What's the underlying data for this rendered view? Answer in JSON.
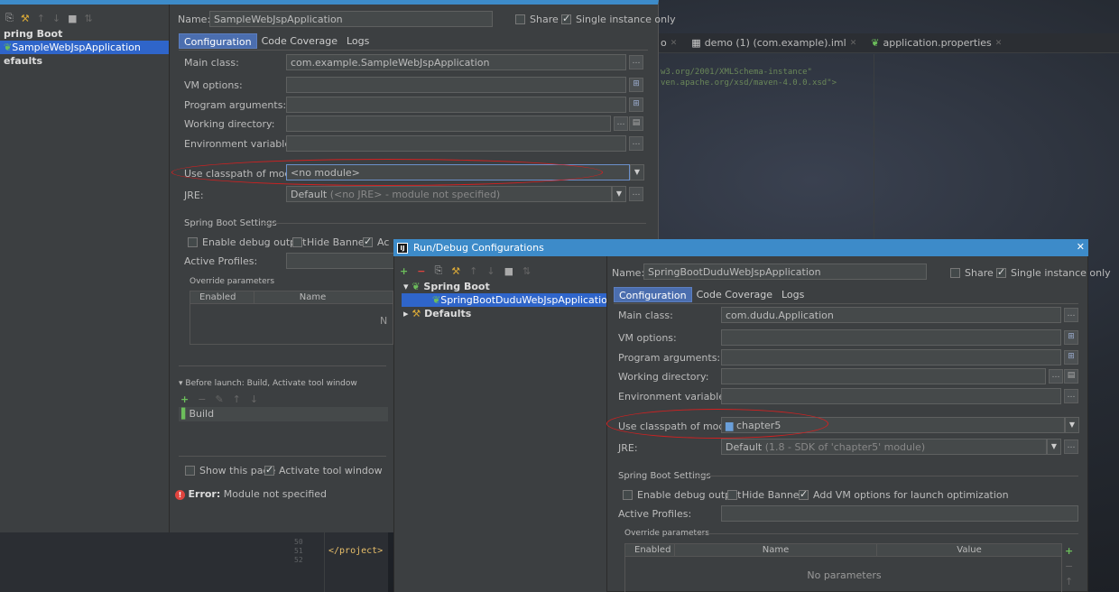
{
  "editor": {
    "tabs": [
      {
        "label": "o"
      },
      {
        "label": "demo (1) (com.example).iml"
      },
      {
        "label": "application.properties"
      }
    ],
    "code_lines": [
      "w3.org/2001/XMLSchema-instance\"",
      "ven.apache.org/xsd/maven-4.0.0.xsd\">"
    ],
    "bottom_line_numbers": [
      "50",
      "51",
      "52"
    ],
    "bottom_code": "</project>"
  },
  "dialog1": {
    "tree": {
      "group_label": "pring Boot",
      "selected_item": "SampleWebJspApplication",
      "defaults_label": "efaults"
    },
    "name_label": "Name:",
    "name_value": "SampleWebJspApplication",
    "share_label": "Share",
    "single_instance_label": "Single instance only",
    "tabs": [
      "Configuration",
      "Code Coverage",
      "Logs"
    ],
    "fields": {
      "main_class_label": "Main class:",
      "main_class_value": "com.example.SampleWebJspApplication",
      "vm_options_label": "VM options:",
      "program_args_label": "Program arguments:",
      "working_dir_label": "Working directory:",
      "env_vars_label": "Environment variables:",
      "classpath_label": "Use classpath of module:",
      "classpath_value": "<no module>",
      "jre_label": "JRE:",
      "jre_value": "Default",
      "jre_hint": "(<no JRE> - module not specified)"
    },
    "spring_boot_settings": "Spring Boot Settings",
    "enable_debug": "Enable debug output",
    "hide_banner": "Hide Banner",
    "add_vm_truncated": "Ac",
    "active_profiles": "Active Profiles:",
    "override_params": "Override parameters",
    "col_enabled": "Enabled",
    "col_name": "Name",
    "no_params_truncated": "N",
    "before_launch": "Before launch: Build, Activate tool window",
    "build_item": "Build",
    "show_page": "Show this page",
    "activate_tool_window": "Activate tool window",
    "error_prefix": "Error:",
    "error_text": "Module not specified"
  },
  "dialog2": {
    "title": "Run/Debug Configurations",
    "tree": {
      "group_label": "Spring Boot",
      "selected_item": "SpringBootDuduWebJspApplication",
      "defaults_label": "Defaults"
    },
    "name_label": "Name:",
    "name_value": "SpringBootDuduWebJspApplication",
    "share_label": "Share",
    "single_instance_label": "Single instance only",
    "tabs": [
      "Configuration",
      "Code Coverage",
      "Logs"
    ],
    "fields": {
      "main_class_label": "Main class:",
      "main_class_value": "com.dudu.Application",
      "vm_options_label": "VM options:",
      "program_args_label": "Program arguments:",
      "working_dir_label": "Working directory:",
      "env_vars_label": "Environment variables:",
      "classpath_label": "Use classpath of module:",
      "classpath_value": "chapter5",
      "jre_label": "JRE:",
      "jre_value": "Default",
      "jre_hint": "(1.8 - SDK of 'chapter5' module)"
    },
    "spring_boot_settings": "Spring Boot Settings",
    "enable_debug": "Enable debug output",
    "hide_banner": "Hide Banner",
    "add_vm": "Add VM options for launch optimization",
    "active_profiles": "Active Profiles:",
    "override_params": "Override parameters",
    "col_enabled": "Enabled",
    "col_name": "Name",
    "col_value": "Value",
    "no_params": "No parameters"
  },
  "colors": {
    "title_bar": "#3d8bc9",
    "selection": "#2f65ca",
    "annotation": "#d42020",
    "error": "#e0443e"
  }
}
